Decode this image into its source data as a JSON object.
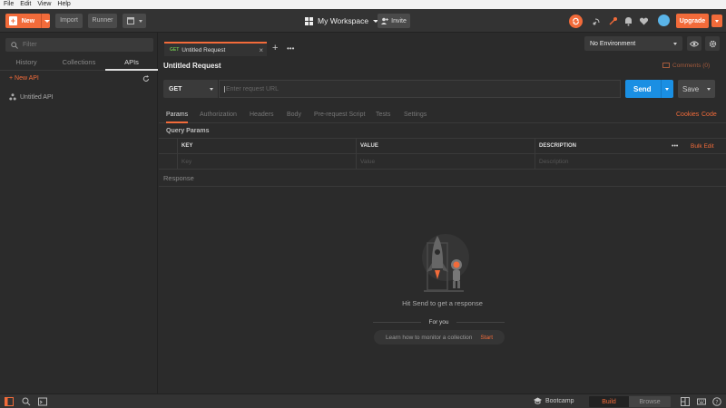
{
  "menubar": {
    "items": [
      "File",
      "Edit",
      "View",
      "Help"
    ]
  },
  "header": {
    "new_label": "New",
    "import_label": "Import",
    "runner_label": "Runner",
    "workspace_label": "My Workspace",
    "invite_label": "Invite",
    "upgrade_label": "Upgrade"
  },
  "sidebar": {
    "filter_placeholder": "Filter",
    "tabs": [
      "History",
      "Collections",
      "APIs"
    ],
    "active_tab": "APIs",
    "new_api_label": "+ New API",
    "items": [
      {
        "label": "Untitled API"
      }
    ]
  },
  "main": {
    "tab": {
      "method": "GET",
      "label": "Untitled Request"
    },
    "environment": "No Environment",
    "request_title": "Untitled Request",
    "comments_label": "Comments (0)",
    "method": "GET",
    "url_placeholder": "Enter request URL",
    "send_label": "Send",
    "save_label": "Save",
    "request_tabs": [
      "Params",
      "Authorization",
      "Headers",
      "Body",
      "Pre-request Script",
      "Tests",
      "Settings"
    ],
    "cookies_label": "Cookies",
    "code_label": "Code",
    "query_params_title": "Query Params",
    "table": {
      "headers": [
        "KEY",
        "VALUE",
        "DESCRIPTION"
      ],
      "placeholders": [
        "Key",
        "Value",
        "Description"
      ],
      "more_label": "•••",
      "bulk_edit_label": "Bulk Edit"
    },
    "response_label": "Response",
    "empty_message": "Hit Send to get a response",
    "for_you_label": "For you",
    "learn_label": "Learn how to monitor a collection",
    "start_label": "Start"
  },
  "footer": {
    "bootcamp_label": "Bootcamp",
    "build_label": "Build",
    "browse_label": "Browse"
  },
  "colors": {
    "accent": "#f26b3a",
    "send": "#1a8fe3",
    "background": "#2b2b2b",
    "header": "#333333"
  }
}
